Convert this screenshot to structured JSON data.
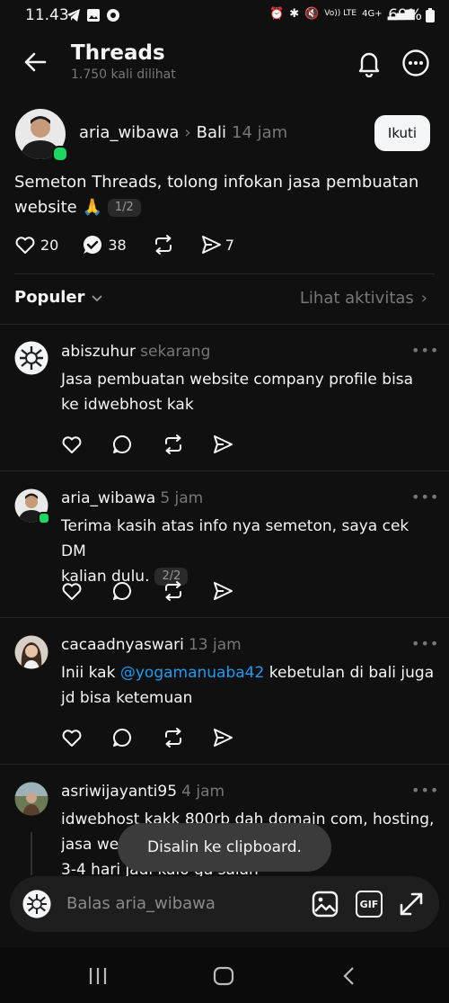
{
  "status_bar": {
    "time": "11.43",
    "net": "4G+",
    "volte": "Vo)) LTE",
    "battery": "69%"
  },
  "header": {
    "title": "Threads",
    "subtitle": "1.750 kali dilihat"
  },
  "post": {
    "username": "aria_wibawa",
    "location": "Bali",
    "time": "14 jam",
    "follow_label": "Ikuti",
    "text_line1": "Semeton Threads, tolong infokan jasa pembuatan",
    "text_line2": "website 🙏",
    "counter": "1/2",
    "likes": "20",
    "replies": "38",
    "shares": "7"
  },
  "sort": {
    "label": "Populer",
    "activity_label": "Lihat aktivitas"
  },
  "replies": [
    {
      "username": "abiszuhur",
      "time": "sekarang",
      "line1": "Jasa pembuatan website company profile bisa",
      "line2": "ke idwebhost kak"
    },
    {
      "username": "aria_wibawa",
      "time": "5 jam",
      "line1": "Terima kasih atas info nya semeton, saya cek DM",
      "line2": "kalian dulu.",
      "counter": "2/2"
    },
    {
      "username": "cacaadnyaswari",
      "time": "13 jam",
      "line1_prefix": "Inii kak ",
      "mention": "@yogamanuaba42",
      "line1_suffix": " kebetulan di bali juga",
      "line2": "jd bisa ketemuan"
    },
    {
      "username": "asriwijayanti95",
      "time": "4 jam",
      "line1": "idwebhost kakk 800rb dah domain com, hosting,",
      "line2": "jasa web s",
      "line3": "3-4 hari jadi kalo ga salah"
    }
  ],
  "toast": "Disalin ke clipboard.",
  "reply_bar": {
    "placeholder": "Balas aria_wibawa",
    "gif_label": "GIF"
  },
  "colors": {
    "background": "#101010",
    "text": "#f3f5f7",
    "muted": "#777777",
    "link": "#1d9bf0",
    "online": "#1ed760"
  }
}
